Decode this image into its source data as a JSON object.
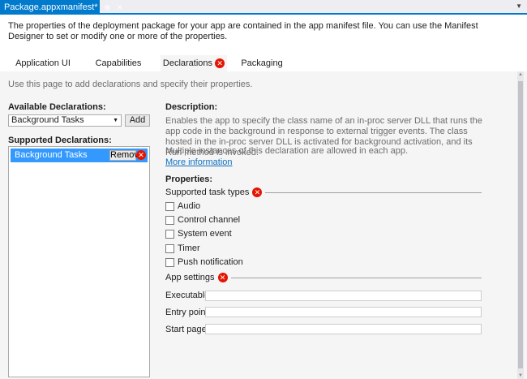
{
  "doc_tab": {
    "title": "Package.appxmanifest*",
    "pin": "⊕",
    "close": "×"
  },
  "header": {
    "description": "The properties of the deployment package for your app are contained in the app manifest file. You can use the Manifest Designer to set or modify one or more of the properties."
  },
  "tabs": [
    {
      "label": "Application UI",
      "active": false,
      "error": false
    },
    {
      "label": "Capabilities",
      "active": false,
      "error": false
    },
    {
      "label": "Declarations",
      "active": true,
      "error": true
    },
    {
      "label": "Packaging",
      "active": false,
      "error": false
    }
  ],
  "content": {
    "hint": "Use this page to add declarations and specify their properties.",
    "available_label": "Available Declarations:",
    "available_selected": "Background Tasks",
    "add_label": "Add",
    "supported_label": "Supported Declarations:",
    "supported_items": [
      {
        "label": "Background Tasks",
        "remove_label": "Remove"
      }
    ],
    "description_label": "Description:",
    "description_text": "Enables the app to specify the class name of an in-proc server DLL that runs the app code in the background in response to external trigger events. The class hosted in the in-proc server DLL is activated for background activation, and its Run method is invoked.",
    "multiple_text": "Multiple instances of this declaration are allowed in each app.",
    "more_info": "More information",
    "properties_label": "Properties:",
    "task_types_label": "Supported task types",
    "task_types": [
      "Audio",
      "Control channel",
      "System event",
      "Timer",
      "Push notification"
    ],
    "app_settings_label": "App settings",
    "fields": [
      {
        "label": "Executable:",
        "value": ""
      },
      {
        "label": "Entry point:",
        "value": ""
      },
      {
        "label": "Start page:",
        "value": ""
      }
    ]
  },
  "colors": {
    "accent": "#007acc",
    "error": "#e51400",
    "selection": "#3399ff",
    "link": "#0e70c0"
  }
}
